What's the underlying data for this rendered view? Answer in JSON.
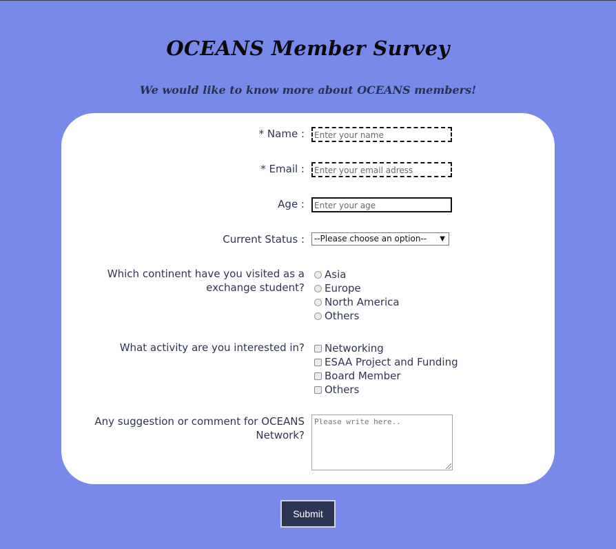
{
  "header": {
    "title": "OCEANS Member Survey",
    "subtitle": "We would like to know more about OCEANS members!"
  },
  "form": {
    "name": {
      "label": "* Name :",
      "placeholder": "Enter your name"
    },
    "email": {
      "label": "* Email :",
      "placeholder": "Enter your email adress"
    },
    "age": {
      "label": "Age :",
      "placeholder": "Enter your age"
    },
    "status": {
      "label": "Current Status :",
      "selected": "--Please choose an option--"
    },
    "continent": {
      "label": "Which continent have you visited as a exchange student?",
      "options": [
        "Asia",
        "Europe",
        "North America",
        "Others"
      ]
    },
    "activity": {
      "label": "What activity are you interested in?",
      "options": [
        "Networking",
        "ESAA Project and Funding",
        "Board Member",
        "Others"
      ]
    },
    "comment": {
      "label": "Any suggestion or comment for OCEANS Network?",
      "placeholder": "Please write here.."
    },
    "submit_label": "Submit"
  },
  "colors": {
    "background": "#7889ea",
    "card": "#ffffff",
    "submit_button": "#2c3553"
  }
}
